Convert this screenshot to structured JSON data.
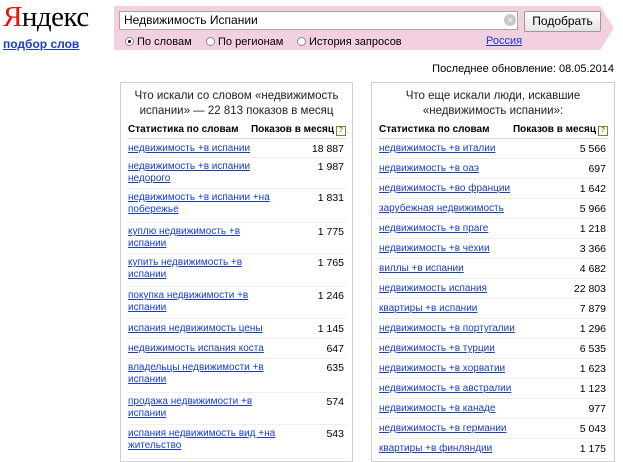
{
  "logo": {
    "first": "Я",
    "rest": "ндекс"
  },
  "service_link": "подбор слов",
  "search": {
    "value": "Недвижимость Испании",
    "clear": "×",
    "button": "Подобрать"
  },
  "modes": [
    {
      "label": "По словам",
      "selected": true
    },
    {
      "label": "По регионам",
      "selected": false
    },
    {
      "label": "История запросов",
      "selected": false
    }
  ],
  "region": "Россия",
  "last_update": "Последнее обновление: 08.05.2014",
  "colors": {
    "accent_band": "#f3d0df",
    "link": "#1a3dc1",
    "logo_red": "#e61400"
  },
  "left_panel": {
    "title": "Что искали со словом «недвижимость испании» — 22 813 показов в месяц",
    "col_phrase": "Статистика по словам",
    "col_count": "Показов в месяц",
    "rows": [
      {
        "phrase": "недвижимость +в испании",
        "count": "18 887"
      },
      {
        "phrase": "недвижимость +в испании недорого",
        "count": "1 987"
      },
      {
        "phrase": "недвижимость +в испании +на побережье",
        "count": "1 831"
      },
      {
        "phrase": "куплю недвижимость +в испании",
        "count": "1 775"
      },
      {
        "phrase": "купить недвижимость +в испании",
        "count": "1 765"
      },
      {
        "phrase": "покупка недвижимости +в испании",
        "count": "1 246"
      },
      {
        "phrase": "испания недвижимость цены",
        "count": "1 145"
      },
      {
        "phrase": "недвижимость испания коста",
        "count": "647"
      },
      {
        "phrase": "владельцы недвижимости +в испании",
        "count": "635"
      },
      {
        "phrase": "продажа недвижимости +в испании",
        "count": "574"
      },
      {
        "phrase": "испания недвижимость вид +на жительство",
        "count": "543"
      }
    ]
  },
  "right_panel": {
    "title": "Что еще искали люди, искавшие «недвижимость испании»:",
    "col_phrase": "Статистика по словам",
    "col_count": "Показов в месяц",
    "rows": [
      {
        "phrase": "недвижимость +в италии",
        "count": "5 566"
      },
      {
        "phrase": "недвижимость +в оаэ",
        "count": "697"
      },
      {
        "phrase": "недвижимость +во франции",
        "count": "1 642"
      },
      {
        "phrase": "зарубежная недвижимость",
        "count": "5 966"
      },
      {
        "phrase": "недвижимость +в праге",
        "count": "1 218"
      },
      {
        "phrase": "недвижимость +в чехии",
        "count": "3 366"
      },
      {
        "phrase": "виллы +в испании",
        "count": "4 682"
      },
      {
        "phrase": "недвижимость испания",
        "count": "22 803"
      },
      {
        "phrase": "квартиры +в испании",
        "count": "7 879"
      },
      {
        "phrase": "недвижимость +в португалии",
        "count": "1 296"
      },
      {
        "phrase": "недвижимость +в турции",
        "count": "6 535"
      },
      {
        "phrase": "недвижимость +в хорватии",
        "count": "1 623"
      },
      {
        "phrase": "недвижимость +в австралии",
        "count": "1 123"
      },
      {
        "phrase": "недвижимость +в канаде",
        "count": "977"
      },
      {
        "phrase": "недвижимость +в германии",
        "count": "5 043"
      },
      {
        "phrase": "квартиры +в финляндии",
        "count": "1 175"
      }
    ]
  }
}
